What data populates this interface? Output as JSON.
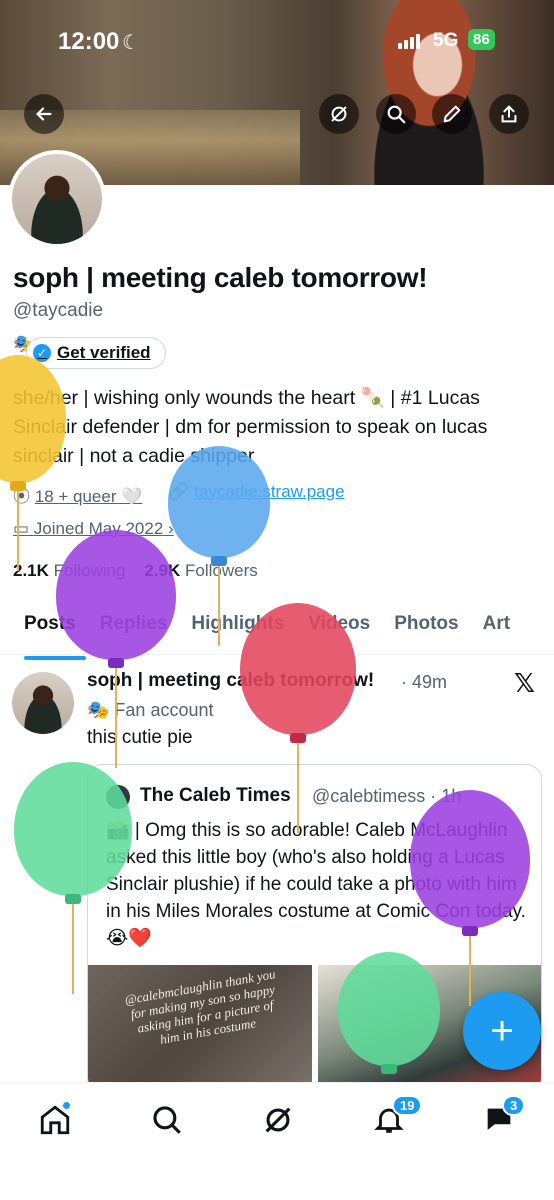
{
  "status": {
    "time": "12:00",
    "network": "5G",
    "battery": "86"
  },
  "profile": {
    "name": "soph | meeting caleb tomorrow!",
    "handle": "@taycadie",
    "fan_label": "🎭 Fan account",
    "get_verified": "Get verified",
    "bio": "she/her | wishing only wounds the heart 🍡 | #1 Lucas Sinclair defender | dm for permission to speak on lucas sinclair | not a cadie shipper",
    "link1": "18 + queer 🤍",
    "link2": "taycadie.straw.page",
    "joined": "Joined May 2022",
    "following_count": "2.1K",
    "following_label": "Following",
    "followers_count": "2.9K",
    "followers_label": "Followers"
  },
  "tabs": [
    "Posts",
    "Replies",
    "Highlights",
    "Videos",
    "Photos",
    "Art"
  ],
  "post": {
    "name": "soph | meeting caleb tomorrow!",
    "time": "· 49m",
    "fan_label": "Fan account",
    "text": "this cutie pie",
    "quote": {
      "name": "The Caleb Times",
      "handle": "@calebtimess · 1h",
      "text": "📸 | Omg this is so adorable! Caleb McLaughlin asked this little boy (who's also holding a Lucas Sinclair plushie) if he could take a photo with him in his Miles Morales costume at Comic Con today. 😭❤️",
      "image_caption": "@calebmclaughlin thank you for making my son so happy asking him for a picture of him in his costume"
    }
  },
  "fab_label": "+",
  "bottom_nav": {
    "notifications_badge": "19",
    "messages_badge": "3"
  },
  "colors": {
    "accent": "#1d9bf0",
    "text": "#0f1419",
    "muted": "#536471"
  }
}
